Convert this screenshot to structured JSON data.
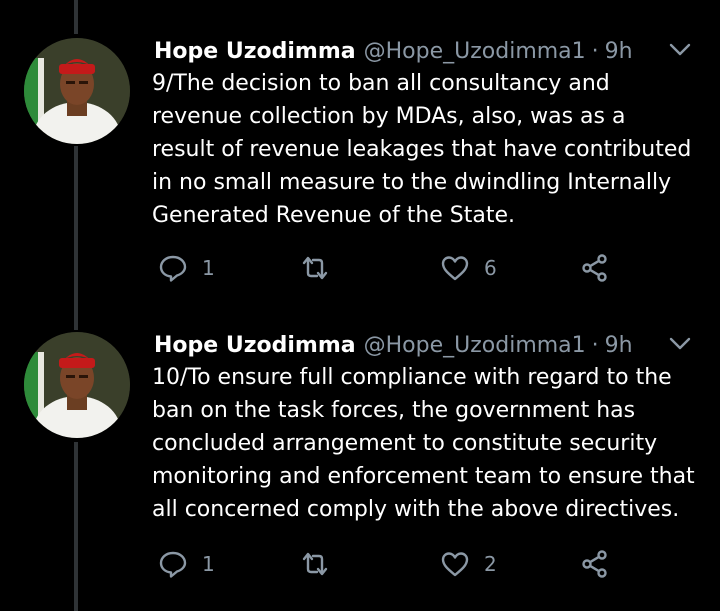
{
  "colors": {
    "background": "#000000",
    "text_primary": "#ffffff",
    "text_secondary": "#8b98a5",
    "thread_line": "#2f3336"
  },
  "tweets": [
    {
      "author_name": "Hope Uzodimma",
      "handle": "@Hope_Uzodimma1",
      "separator": "·",
      "time": "9h",
      "avatar_icon": "user-avatar",
      "text_lines": [
        "9/The decision to ban all consultancy and",
        "revenue collection by MDAs, also, was as a",
        "result of revenue leakages that have contributed",
        "in no small measure to the dwindling Internally",
        "Generated Revenue of the State."
      ],
      "replies": "1",
      "retweets": "",
      "likes": "6",
      "icons": [
        "reply-icon",
        "retweet-icon",
        "like-icon",
        "share-icon",
        "chevron-down-icon"
      ]
    },
    {
      "author_name": "Hope Uzodimma",
      "handle": "@Hope_Uzodimma1",
      "separator": "·",
      "time": "9h",
      "avatar_icon": "user-avatar",
      "text_lines": [
        "10/To ensure full compliance with regard to the",
        "ban on the task forces, the government has",
        "concluded arrangement to constitute security",
        "monitoring and enforcement team to ensure that",
        "all concerned comply with the above directives."
      ],
      "replies": "1",
      "retweets": "",
      "likes": "2",
      "icons": [
        "reply-icon",
        "retweet-icon",
        "like-icon",
        "share-icon",
        "chevron-down-icon"
      ]
    }
  ]
}
